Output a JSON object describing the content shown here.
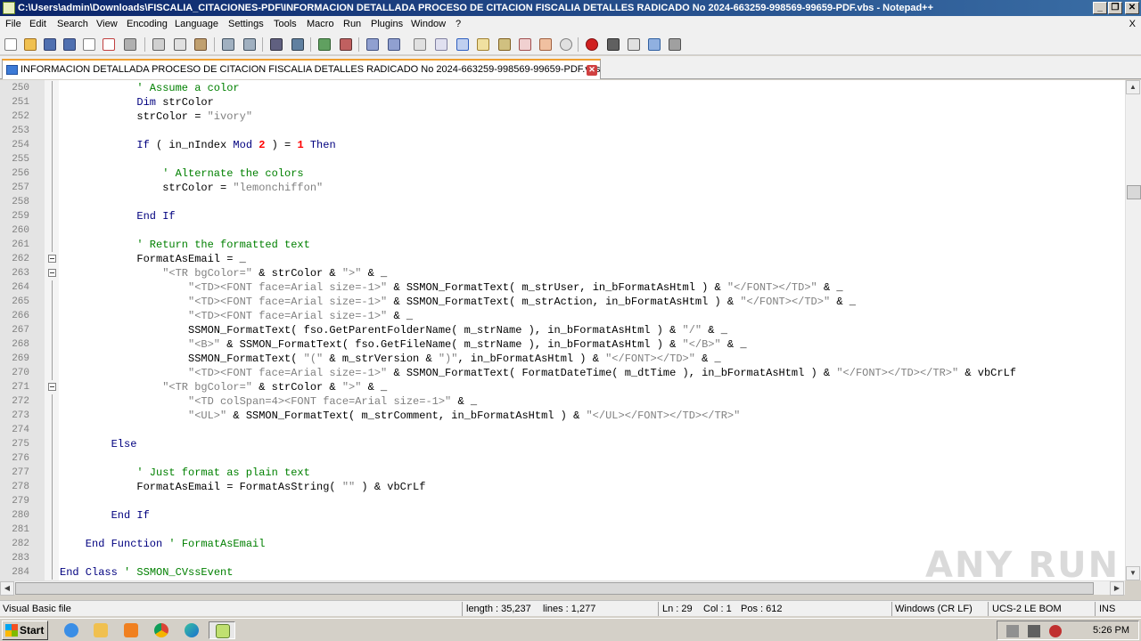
{
  "window": {
    "title": "C:\\Users\\admin\\Downloads\\FISCALIA_CITACIONES-PDF\\INFORMACION DETALLADA PROCESO DE CITACION FISCALIA DETALLES RADICADO No 2024-663259-998569-99659-PDF.vbs - Notepad++",
    "minimize_label": "_",
    "maximize_label": "❐",
    "close_label": "✕"
  },
  "menu": {
    "items": [
      "File",
      "Edit",
      "Search",
      "View",
      "Encoding",
      "Language",
      "Settings",
      "Tools",
      "Macro",
      "Run",
      "Plugins",
      "Window",
      "?"
    ],
    "close_label": "X"
  },
  "toolbar": {
    "icons": [
      "new-file-icon",
      "open-file-icon",
      "save-icon",
      "save-all-icon",
      "close-icon",
      "close-all-icon",
      "print-icon",
      "cut-icon",
      "copy-icon",
      "paste-icon",
      "undo-icon",
      "redo-icon",
      "find-icon",
      "replace-icon",
      "zoom-in-icon",
      "zoom-out-icon",
      "sync-vertical-icon",
      "sync-horizontal-icon",
      "word-wrap-icon",
      "show-all-chars-icon",
      "indent-guide-icon",
      "language-icon",
      "doc-map-icon",
      "function-list-icon",
      "folder-workspace-icon",
      "monitoring-icon",
      "record-macro-icon",
      "stop-macro-icon",
      "play-macro-icon",
      "run-macro-multiple-icon",
      "save-macro-icon"
    ]
  },
  "tab": {
    "label": "INFORMACION DETALLADA PROCESO DE CITACION FISCALIA DETALLES RADICADO No 2024-663259-998569-99659-PDF.vbs",
    "close_label": "✕"
  },
  "editor": {
    "lines": [
      {
        "n": "250",
        "indent": 12,
        "parts": [
          {
            "c": "cm",
            "t": "' Assume a color"
          }
        ]
      },
      {
        "n": "251",
        "indent": 12,
        "parts": [
          {
            "c": "kw",
            "t": "Dim"
          },
          {
            "c": "op",
            "t": " strColor"
          }
        ]
      },
      {
        "n": "252",
        "indent": 12,
        "parts": [
          {
            "c": "op",
            "t": "strColor = "
          },
          {
            "c": "st",
            "t": "\"ivory\""
          }
        ]
      },
      {
        "n": "253",
        "indent": 0,
        "parts": []
      },
      {
        "n": "254",
        "indent": 12,
        "parts": [
          {
            "c": "kw",
            "t": "If"
          },
          {
            "c": "op",
            "t": " ( in_nIndex "
          },
          {
            "c": "kw",
            "t": "Mod"
          },
          {
            "c": "op",
            "t": " "
          },
          {
            "c": "nm",
            "t": "2"
          },
          {
            "c": "op",
            "t": " ) = "
          },
          {
            "c": "nm",
            "t": "1"
          },
          {
            "c": "op",
            "t": " "
          },
          {
            "c": "kw",
            "t": "Then"
          }
        ]
      },
      {
        "n": "255",
        "indent": 0,
        "parts": []
      },
      {
        "n": "256",
        "indent": 16,
        "parts": [
          {
            "c": "cm",
            "t": "' Alternate the colors"
          }
        ]
      },
      {
        "n": "257",
        "indent": 16,
        "parts": [
          {
            "c": "op",
            "t": "strColor = "
          },
          {
            "c": "st",
            "t": "\"lemonchiffon\""
          }
        ]
      },
      {
        "n": "258",
        "indent": 0,
        "parts": []
      },
      {
        "n": "259",
        "indent": 12,
        "parts": [
          {
            "c": "kw",
            "t": "End If"
          }
        ]
      },
      {
        "n": "260",
        "indent": 0,
        "parts": []
      },
      {
        "n": "261",
        "indent": 12,
        "parts": [
          {
            "c": "cm",
            "t": "' Return the formatted text"
          }
        ]
      },
      {
        "n": "262",
        "indent": 12,
        "parts": [
          {
            "c": "op",
            "t": "FormatAsEmail = _"
          }
        ]
      },
      {
        "n": "263",
        "indent": 16,
        "parts": [
          {
            "c": "st",
            "t": "\"<TR bgColor=\""
          },
          {
            "c": "op",
            "t": " & strColor & "
          },
          {
            "c": "st",
            "t": "\">\""
          },
          {
            "c": "op",
            "t": " & _"
          }
        ]
      },
      {
        "n": "264",
        "indent": 20,
        "parts": [
          {
            "c": "st",
            "t": "\"<TD><FONT face=Arial size=-1>\""
          },
          {
            "c": "op",
            "t": " & SSMON_FormatText( m_strUser, in_bFormatAsHtml ) & "
          },
          {
            "c": "st",
            "t": "\"</FONT></TD>\""
          },
          {
            "c": "op",
            "t": " & _"
          }
        ]
      },
      {
        "n": "265",
        "indent": 20,
        "parts": [
          {
            "c": "st",
            "t": "\"<TD><FONT face=Arial size=-1>\""
          },
          {
            "c": "op",
            "t": " & SSMON_FormatText( m_strAction, in_bFormatAsHtml ) & "
          },
          {
            "c": "st",
            "t": "\"</FONT></TD>\""
          },
          {
            "c": "op",
            "t": " & _"
          }
        ]
      },
      {
        "n": "266",
        "indent": 20,
        "parts": [
          {
            "c": "st",
            "t": "\"<TD><FONT face=Arial size=-1>\""
          },
          {
            "c": "op",
            "t": " & _"
          }
        ]
      },
      {
        "n": "267",
        "indent": 20,
        "parts": [
          {
            "c": "op",
            "t": "SSMON_FormatText( fso.GetParentFolderName( m_strName ), in_bFormatAsHtml ) & "
          },
          {
            "c": "st",
            "t": "\"/\""
          },
          {
            "c": "op",
            "t": " & _"
          }
        ]
      },
      {
        "n": "268",
        "indent": 20,
        "parts": [
          {
            "c": "st",
            "t": "\"<B>\""
          },
          {
            "c": "op",
            "t": " & SSMON_FormatText( fso.GetFileName( m_strName ), in_bFormatAsHtml ) & "
          },
          {
            "c": "st",
            "t": "\"</B>\""
          },
          {
            "c": "op",
            "t": " & _"
          }
        ]
      },
      {
        "n": "269",
        "indent": 20,
        "parts": [
          {
            "c": "op",
            "t": "SSMON_FormatText( "
          },
          {
            "c": "st",
            "t": "\"(\""
          },
          {
            "c": "op",
            "t": " & m_strVersion & "
          },
          {
            "c": "st",
            "t": "\")\""
          },
          {
            "c": "op",
            "t": ", in_bFormatAsHtml ) & "
          },
          {
            "c": "st",
            "t": "\"</FONT></TD>\""
          },
          {
            "c": "op",
            "t": " & _"
          }
        ]
      },
      {
        "n": "270",
        "indent": 20,
        "parts": [
          {
            "c": "st",
            "t": "\"<TD><FONT face=Arial size=-1>\""
          },
          {
            "c": "op",
            "t": " & SSMON_FormatText( FormatDateTime( m_dtTime ), in_bFormatAsHtml ) & "
          },
          {
            "c": "st",
            "t": "\"</FONT></TD></TR>\""
          },
          {
            "c": "op",
            "t": " & vbCrLf"
          }
        ]
      },
      {
        "n": "271",
        "indent": 16,
        "parts": [
          {
            "c": "st",
            "t": "\"<TR bgColor=\""
          },
          {
            "c": "op",
            "t": " & strColor & "
          },
          {
            "c": "st",
            "t": "\">\""
          },
          {
            "c": "op",
            "t": " & _"
          }
        ]
      },
      {
        "n": "272",
        "indent": 20,
        "parts": [
          {
            "c": "st",
            "t": "\"<TD colSpan=4><FONT face=Arial size=-1>\""
          },
          {
            "c": "op",
            "t": " & _"
          }
        ]
      },
      {
        "n": "273",
        "indent": 20,
        "parts": [
          {
            "c": "st",
            "t": "\"<UL>\""
          },
          {
            "c": "op",
            "t": " & SSMON_FormatText( m_strComment, in_bFormatAsHtml ) & "
          },
          {
            "c": "st",
            "t": "\"</UL></FONT></TD></TR>\""
          }
        ]
      },
      {
        "n": "274",
        "indent": 0,
        "parts": []
      },
      {
        "n": "275",
        "indent": 8,
        "parts": [
          {
            "c": "kw",
            "t": "Else"
          }
        ]
      },
      {
        "n": "276",
        "indent": 0,
        "parts": []
      },
      {
        "n": "277",
        "indent": 12,
        "parts": [
          {
            "c": "cm",
            "t": "' Just format as plain text"
          }
        ]
      },
      {
        "n": "278",
        "indent": 12,
        "parts": [
          {
            "c": "op",
            "t": "FormatAsEmail = FormatAsString( "
          },
          {
            "c": "st",
            "t": "\"\""
          },
          {
            "c": "op",
            "t": " ) & vbCrLf"
          }
        ]
      },
      {
        "n": "279",
        "indent": 0,
        "parts": []
      },
      {
        "n": "280",
        "indent": 8,
        "parts": [
          {
            "c": "kw",
            "t": "End If"
          }
        ]
      },
      {
        "n": "281",
        "indent": 0,
        "parts": []
      },
      {
        "n": "282",
        "indent": 4,
        "parts": [
          {
            "c": "kw",
            "t": "End Function"
          },
          {
            "c": "op",
            "t": " "
          },
          {
            "c": "cm",
            "t": "' FormatAsEmail"
          }
        ]
      },
      {
        "n": "283",
        "indent": 0,
        "parts": []
      },
      {
        "n": "284",
        "indent": 0,
        "parts": [
          {
            "c": "kw",
            "t": "End Class"
          },
          {
            "c": "op",
            "t": " "
          },
          {
            "c": "cm",
            "t": "' SSMON_CVssEvent"
          }
        ]
      }
    ],
    "fold_markers": [
      "262",
      "263",
      "271"
    ]
  },
  "statusbar": {
    "file_type": "Visual Basic file",
    "length": "length : 35,237",
    "lines": "lines : 1,277",
    "ln": "Ln : 29",
    "col": "Col : 1",
    "pos": "Pos : 612",
    "eol": "Windows (CR LF)",
    "encoding": "UCS-2 LE BOM",
    "mode": "INS"
  },
  "taskbar": {
    "start_label": "Start",
    "icons": [
      "internet-explorer-icon",
      "file-explorer-icon",
      "media-player-icon",
      "chrome-icon",
      "edge-icon",
      "notepad-plus-plus-icon"
    ],
    "tray_icons": [
      "volume-icon",
      "network-icon",
      "security-icon"
    ],
    "clock": "5:26 PM"
  },
  "watermark": "ANY RUN",
  "colors": {
    "keyword": "#00007f",
    "comment": "#008000",
    "string": "#808080",
    "number": "#ff0000",
    "title_bar": "#0a246a"
  }
}
